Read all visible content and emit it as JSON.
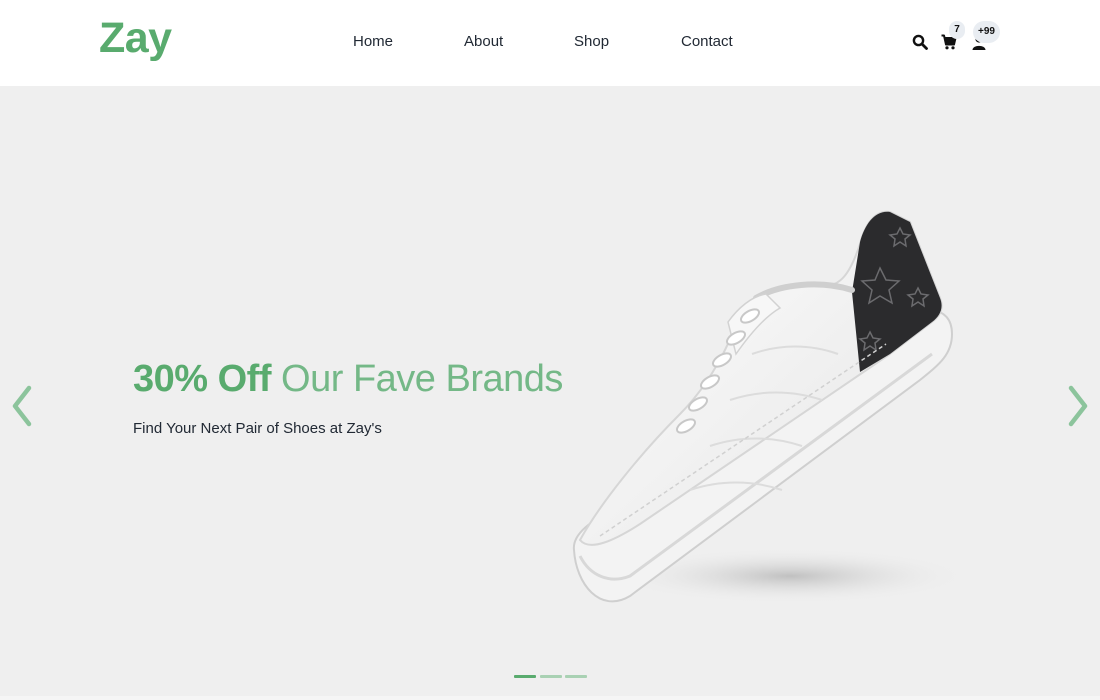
{
  "brand": {
    "logo_text": "Zay",
    "accent_color": "#59ab6e",
    "hero_bg_color": "#efefef"
  },
  "nav": {
    "items": [
      {
        "label": "Home"
      },
      {
        "label": "About"
      },
      {
        "label": "Shop"
      },
      {
        "label": "Contact"
      }
    ]
  },
  "header_icons": {
    "search": {
      "icon": "search-icon"
    },
    "cart": {
      "icon": "cart-icon",
      "badge": "7"
    },
    "user": {
      "icon": "user-icon",
      "badge": "+99"
    }
  },
  "hero": {
    "headline_strong": "30% Off",
    "headline_light": "Our Fave Brands",
    "subline": "Find Your Next Pair of Shoes at Zay's",
    "image": "white-sneaker-with-black-heel-panel",
    "prev_icon": "chevron-left-icon",
    "next_icon": "chevron-right-icon",
    "slide_count": 3,
    "active_slide": 1
  }
}
